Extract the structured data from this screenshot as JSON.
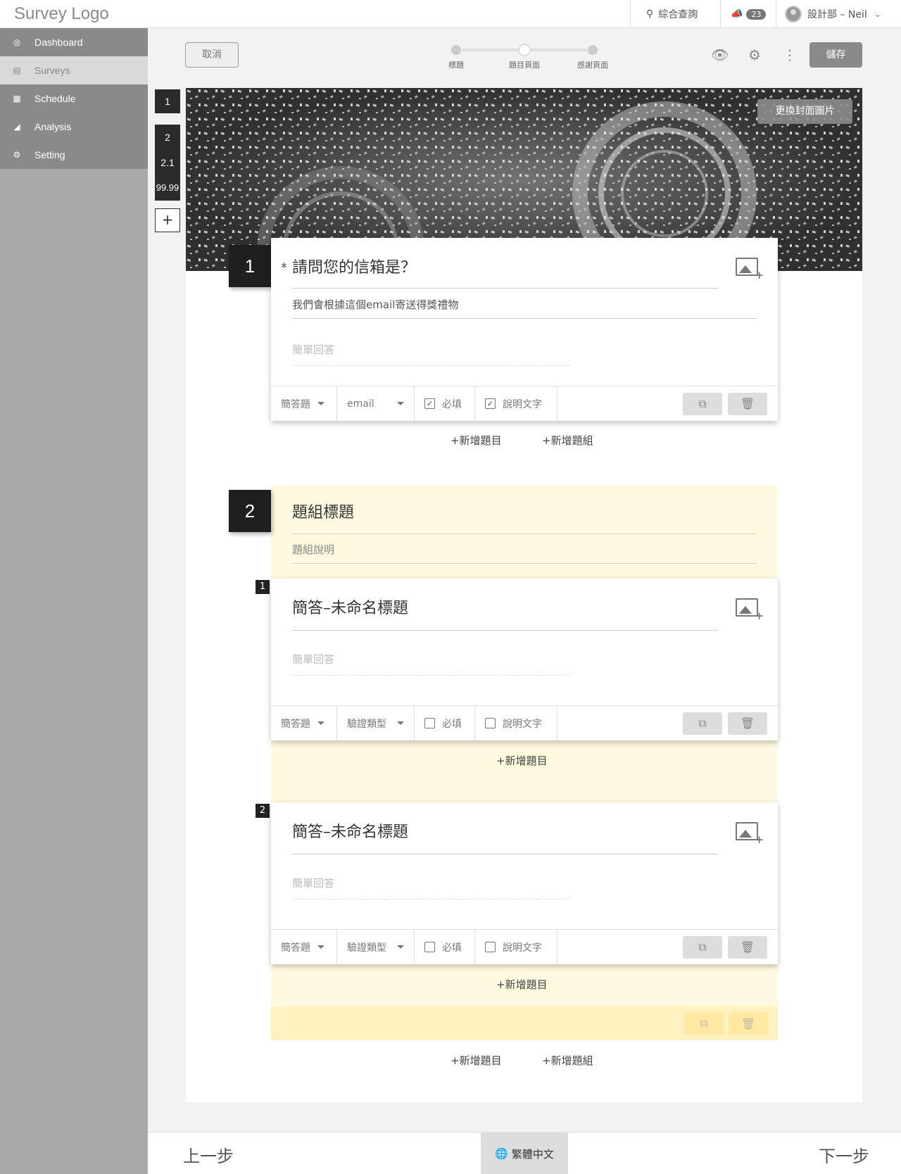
{
  "app": {
    "logo": "Survey Logo"
  },
  "topbar": {
    "search_label": "綜合查詢",
    "notice_count": "23",
    "user_label": "設計部 – Neil"
  },
  "sidebar": {
    "items": [
      {
        "label": "Dashboard",
        "icon": "dashboard-icon"
      },
      {
        "label": "Surveys",
        "icon": "document-icon"
      },
      {
        "label": "Schedule",
        "icon": "calendar-icon"
      },
      {
        "label": "Analysis",
        "icon": "area-chart-icon"
      },
      {
        "label": "Setting",
        "icon": "gear-icon"
      }
    ]
  },
  "page_tabs": [
    "1",
    "2",
    "2.1",
    "99.99",
    "+"
  ],
  "toolbar": {
    "cancel_label": "取消",
    "steps": [
      "標題",
      "題目頁面",
      "感謝頁面"
    ],
    "current_step": 2,
    "save_label": "儲存"
  },
  "cover": {
    "change_label": "更換封面圖片"
  },
  "question1": {
    "number": "1",
    "required_mark": "*",
    "title": "請問您的信箱是？",
    "description": "我們會根據這個email寄送得獎禮物",
    "answer_placeholder": "簡單回答",
    "type_label": "簡答題",
    "validation_label": "email",
    "required_label": "必填",
    "required_checked": true,
    "desc_label": "說明文字",
    "desc_checked": true
  },
  "add_question_label": "+新增題目",
  "add_group_label": "+新增題組",
  "group": {
    "number": "2",
    "title": "題組標題",
    "description": "題組說明",
    "questions": [
      {
        "number": "1",
        "title": "簡答–未命名標題",
        "answer_placeholder": "簡單回答",
        "type_label": "簡答題",
        "validation_label": "驗證類型",
        "required_label": "必填",
        "desc_label": "說明文字"
      },
      {
        "number": "2",
        "title": "簡答–未命名標題",
        "answer_placeholder": "簡單回答",
        "type_label": "簡答題",
        "validation_label": "驗證類型",
        "required_label": "必填",
        "desc_label": "說明文字"
      }
    ]
  },
  "bottom": {
    "prev_label": "上一步",
    "lang_label": "繁體中文",
    "next_label": "下一步"
  }
}
